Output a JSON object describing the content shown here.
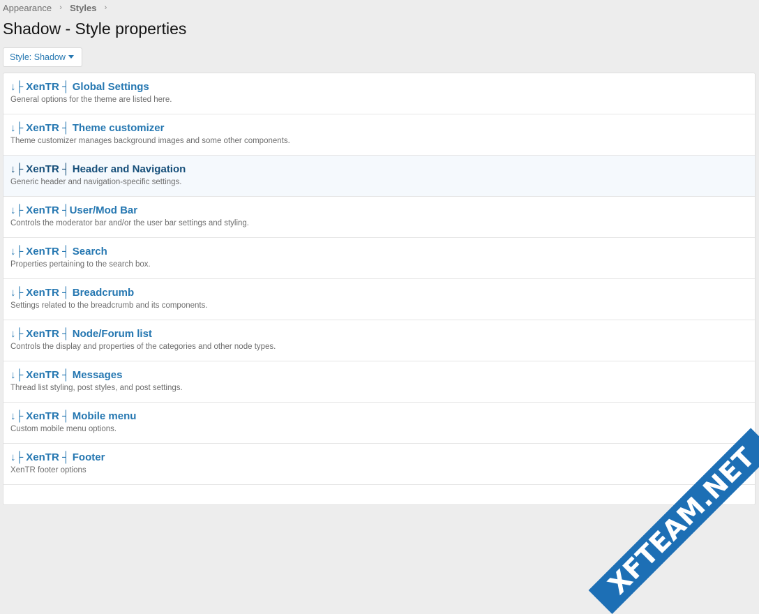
{
  "breadcrumb": [
    {
      "label": "Appearance"
    },
    {
      "label": "Styles"
    }
  ],
  "breadcrumb_separator": "›",
  "page_title": "Shadow - Style properties",
  "style_chooser": {
    "label": "Style: Shadow",
    "icon": "caret-down-icon"
  },
  "groups": [
    {
      "title": "↓├ XenTR ┤ Global Settings",
      "description": "General options for the theme are listed here."
    },
    {
      "title": "↓├ XenTR ┤ Theme customizer",
      "description": "Theme customizer manages background images and some other components."
    },
    {
      "title": "↓├ XenTR ┤ Header and Navigation",
      "description": "Generic header and navigation-specific settings."
    },
    {
      "title": "↓├ XenTR ┤User/Mod Bar",
      "description": "Controls the moderator bar and/or the user bar settings and styling."
    },
    {
      "title": "↓├ XenTR ┤ Search",
      "description": "Properties pertaining to the search box."
    },
    {
      "title": "↓├ XenTR ┤ Breadcrumb",
      "description": "Settings related to the breadcrumb and its components."
    },
    {
      "title": "↓├ XenTR ┤ Node/Forum list",
      "description": "Controls the display and properties of the categories and other node types."
    },
    {
      "title": "↓├ XenTR ┤ Messages",
      "description": "Thread list styling, post styles, and post settings."
    },
    {
      "title": "↓├ XenTR ┤ Mobile menu",
      "description": "Custom mobile menu options."
    },
    {
      "title": "↓├ XenTR ┤ Footer",
      "description": "XenTR footer options"
    }
  ],
  "watermark": "XFTEAM.NET",
  "colors": {
    "accent": "#2577b1",
    "background": "#ededed",
    "hover_row": "#f5f9fd",
    "watermark": "#1d6fb5"
  }
}
